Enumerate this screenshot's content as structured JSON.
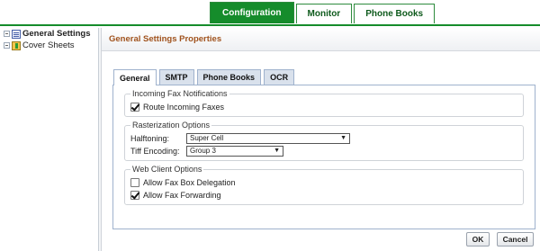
{
  "top_tabs": [
    {
      "label": "Configuration"
    },
    {
      "label": "Monitor"
    },
    {
      "label": "Phone Books"
    }
  ],
  "tree": {
    "items": [
      {
        "label": "General Settings",
        "icon": "settings-list-icon",
        "selected": true
      },
      {
        "label": "Cover Sheets",
        "icon": "cover-sheet-icon",
        "selected": false
      }
    ]
  },
  "panel": {
    "title": "General Settings Properties",
    "tabs": [
      {
        "label": "General"
      },
      {
        "label": "SMTP"
      },
      {
        "label": "Phone Books"
      },
      {
        "label": "OCR"
      }
    ],
    "incoming": {
      "legend": "Incoming Fax Notifications",
      "route_label": "Route Incoming Faxes",
      "route_checked": true
    },
    "raster": {
      "legend": "Rasterization Options",
      "halftoning_label": "Halftoning:",
      "halftoning_value": "Super Cell",
      "tiff_label": "Tiff Encoding:",
      "tiff_value": "Group 3"
    },
    "web": {
      "legend": "Web Client Options",
      "delegation_label": "Allow Fax Box Delegation",
      "delegation_checked": false,
      "forwarding_label": "Allow Fax Forwarding",
      "forwarding_checked": true
    }
  },
  "buttons": {
    "ok": "OK",
    "cancel": "Cancel"
  },
  "colors": {
    "accent": "#158c2b",
    "header_text": "#a0521d",
    "tab_border": "#9fb2cd"
  }
}
